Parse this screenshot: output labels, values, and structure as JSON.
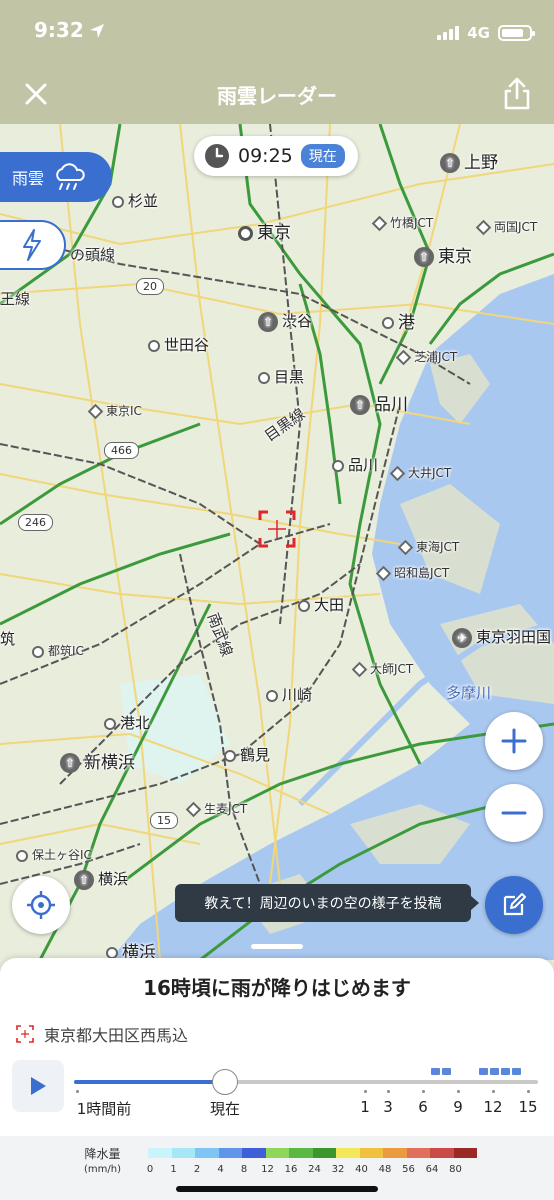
{
  "status": {
    "time": "9:32",
    "network": "4G"
  },
  "header": {
    "title": "雨雲レーダー"
  },
  "map": {
    "time_pill": {
      "time": "09:25",
      "badge": "現在"
    },
    "rain_tab": {
      "label": "雨雲",
      "icon": "rain-cloud-icon"
    },
    "thunder_tab": {
      "icon": "lightning-icon"
    },
    "labels": {
      "suginami": "杉並",
      "tokyo_city": "東京",
      "ueno": "上野",
      "takebashi_jct": "竹橋JCT",
      "ryogoku_jct": "両国JCT",
      "tokyo_station": "東京",
      "shibuya": "渋谷",
      "minato": "港",
      "shibaura_jct": "芝浦JCT",
      "setagaya": "世田谷",
      "meguro": "目黒",
      "shinagawa_station": "品川",
      "tokyo_ic": "東京IC",
      "shinagawa": "品川",
      "oi_jct": "大井JCT",
      "meguro_line": "目黒線",
      "yamanote_head": "の頭線",
      "line_left": "王線",
      "tokai_jct": "東海JCT",
      "showajima_jct": "昭和島JCT",
      "ota": "大田",
      "haneda": "東京羽田国",
      "tsuzuki": "筑",
      "tsuzuki_ic": "都筑IC",
      "nambu_line": "南武線",
      "daishi_jct": "大師JCT",
      "tamagawa": "多摩川",
      "kawasaki": "川崎",
      "kohoku": "港北",
      "shin_yokohama": "新横浜",
      "tsurumi": "鶴見",
      "namamugi_jct": "生麦JCT",
      "hodogaya_ic": "保土ヶ谷IC",
      "yokohama_station": "横浜",
      "yokohama": "横浜",
      "route_20": "20",
      "route_466": "466",
      "route_246": "246",
      "route_15": "15"
    },
    "post_tooltip": "教えて！周辺のいまの空の様子を投稿"
  },
  "forecast": {
    "message": "16時頃に雨が降りはじめます",
    "location": "東京都大田区西馬込"
  },
  "timeline": {
    "labels": [
      "1時間前",
      "現在",
      "1",
      "3",
      "6",
      "9",
      "12",
      "15"
    ],
    "current_position": 0.325
  },
  "legend": {
    "label": "降水量",
    "unit": "(mm/h)",
    "values": [
      "0",
      "1",
      "2",
      "4",
      "8",
      "12",
      "16",
      "24",
      "32",
      "40",
      "48",
      "56",
      "64",
      "80"
    ],
    "colors": [
      "#c9f4fb",
      "#a6e7f6",
      "#7ec5f3",
      "#5f96ea",
      "#3e5fd9",
      "#8fd65a",
      "#5cb845",
      "#3a962d",
      "#f3e75a",
      "#f2c03f",
      "#eb9a3d",
      "#e0705c",
      "#c94a46",
      "#9b2a26"
    ]
  }
}
